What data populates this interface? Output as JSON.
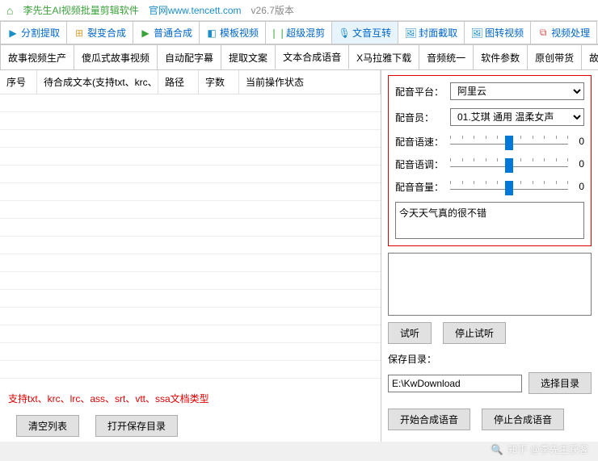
{
  "title": {
    "app": "李先生AI视频批量剪辑软件",
    "site": "官网www.tencett.com",
    "version": "v26.7版本"
  },
  "top_tabs": [
    {
      "icon": "▶",
      "color": "#1b8dc9",
      "label": "分割提取"
    },
    {
      "icon": "⊞",
      "color": "#d9a13b",
      "label": "裂变合成"
    },
    {
      "icon": "▶",
      "color": "#3aa23a",
      "label": "普通合成"
    },
    {
      "icon": "◧",
      "color": "#1b8dc9",
      "label": "模板视频"
    },
    {
      "icon": "❘❘",
      "color": "#3aa23a",
      "label": "超级混剪"
    },
    {
      "icon": "🎙",
      "color": "#1b8dc9",
      "label": "文音互转",
      "active": true
    },
    {
      "icon": "🖼",
      "color": "#1b8dc9",
      "label": "封面截取"
    },
    {
      "icon": "🖼",
      "color": "#1b8dc9",
      "label": "图转视频"
    },
    {
      "icon": "⧉",
      "color": "#d9534f",
      "label": "视频处理"
    }
  ],
  "sub_tabs": [
    "故事视频生产",
    "傻瓜式故事视频",
    "自动配字幕",
    "提取文案",
    "文本合成语音",
    "X马拉雅下载",
    "音频统一",
    "软件参数",
    "原创带货",
    "故事视频"
  ],
  "sub_active": 4,
  "table": {
    "cols": [
      "序号",
      "待合成文本(支持txt、krc、...",
      "路径",
      "字数",
      "当前操作状态"
    ]
  },
  "hint": "支持txt、krc、lrc、ass、srt、vtt、ssa文档类型",
  "bottom_btns": {
    "clear": "清空列表",
    "open": "打开保存目录"
  },
  "panel": {
    "platform_label": "配音平台：",
    "platform_value": "阿里云",
    "voice_label": "配音员：",
    "voice_value": "01.艾琪 通用 温柔女声",
    "speed_label": "配音语速：",
    "pitch_label": "配音语调：",
    "volume_label": "配音音量：",
    "slider_val": "0",
    "text_input": "今天天气真的很不错",
    "preview_btn": "试听",
    "stop_preview_btn": "停止试听",
    "save_label": "保存目录：",
    "save_path": "E:\\KwDownload",
    "browse_btn": "选择目录",
    "start_btn": "开始合成语音",
    "stop_btn": "停止合成语音"
  },
  "watermark": "知乎 @李先生获客"
}
